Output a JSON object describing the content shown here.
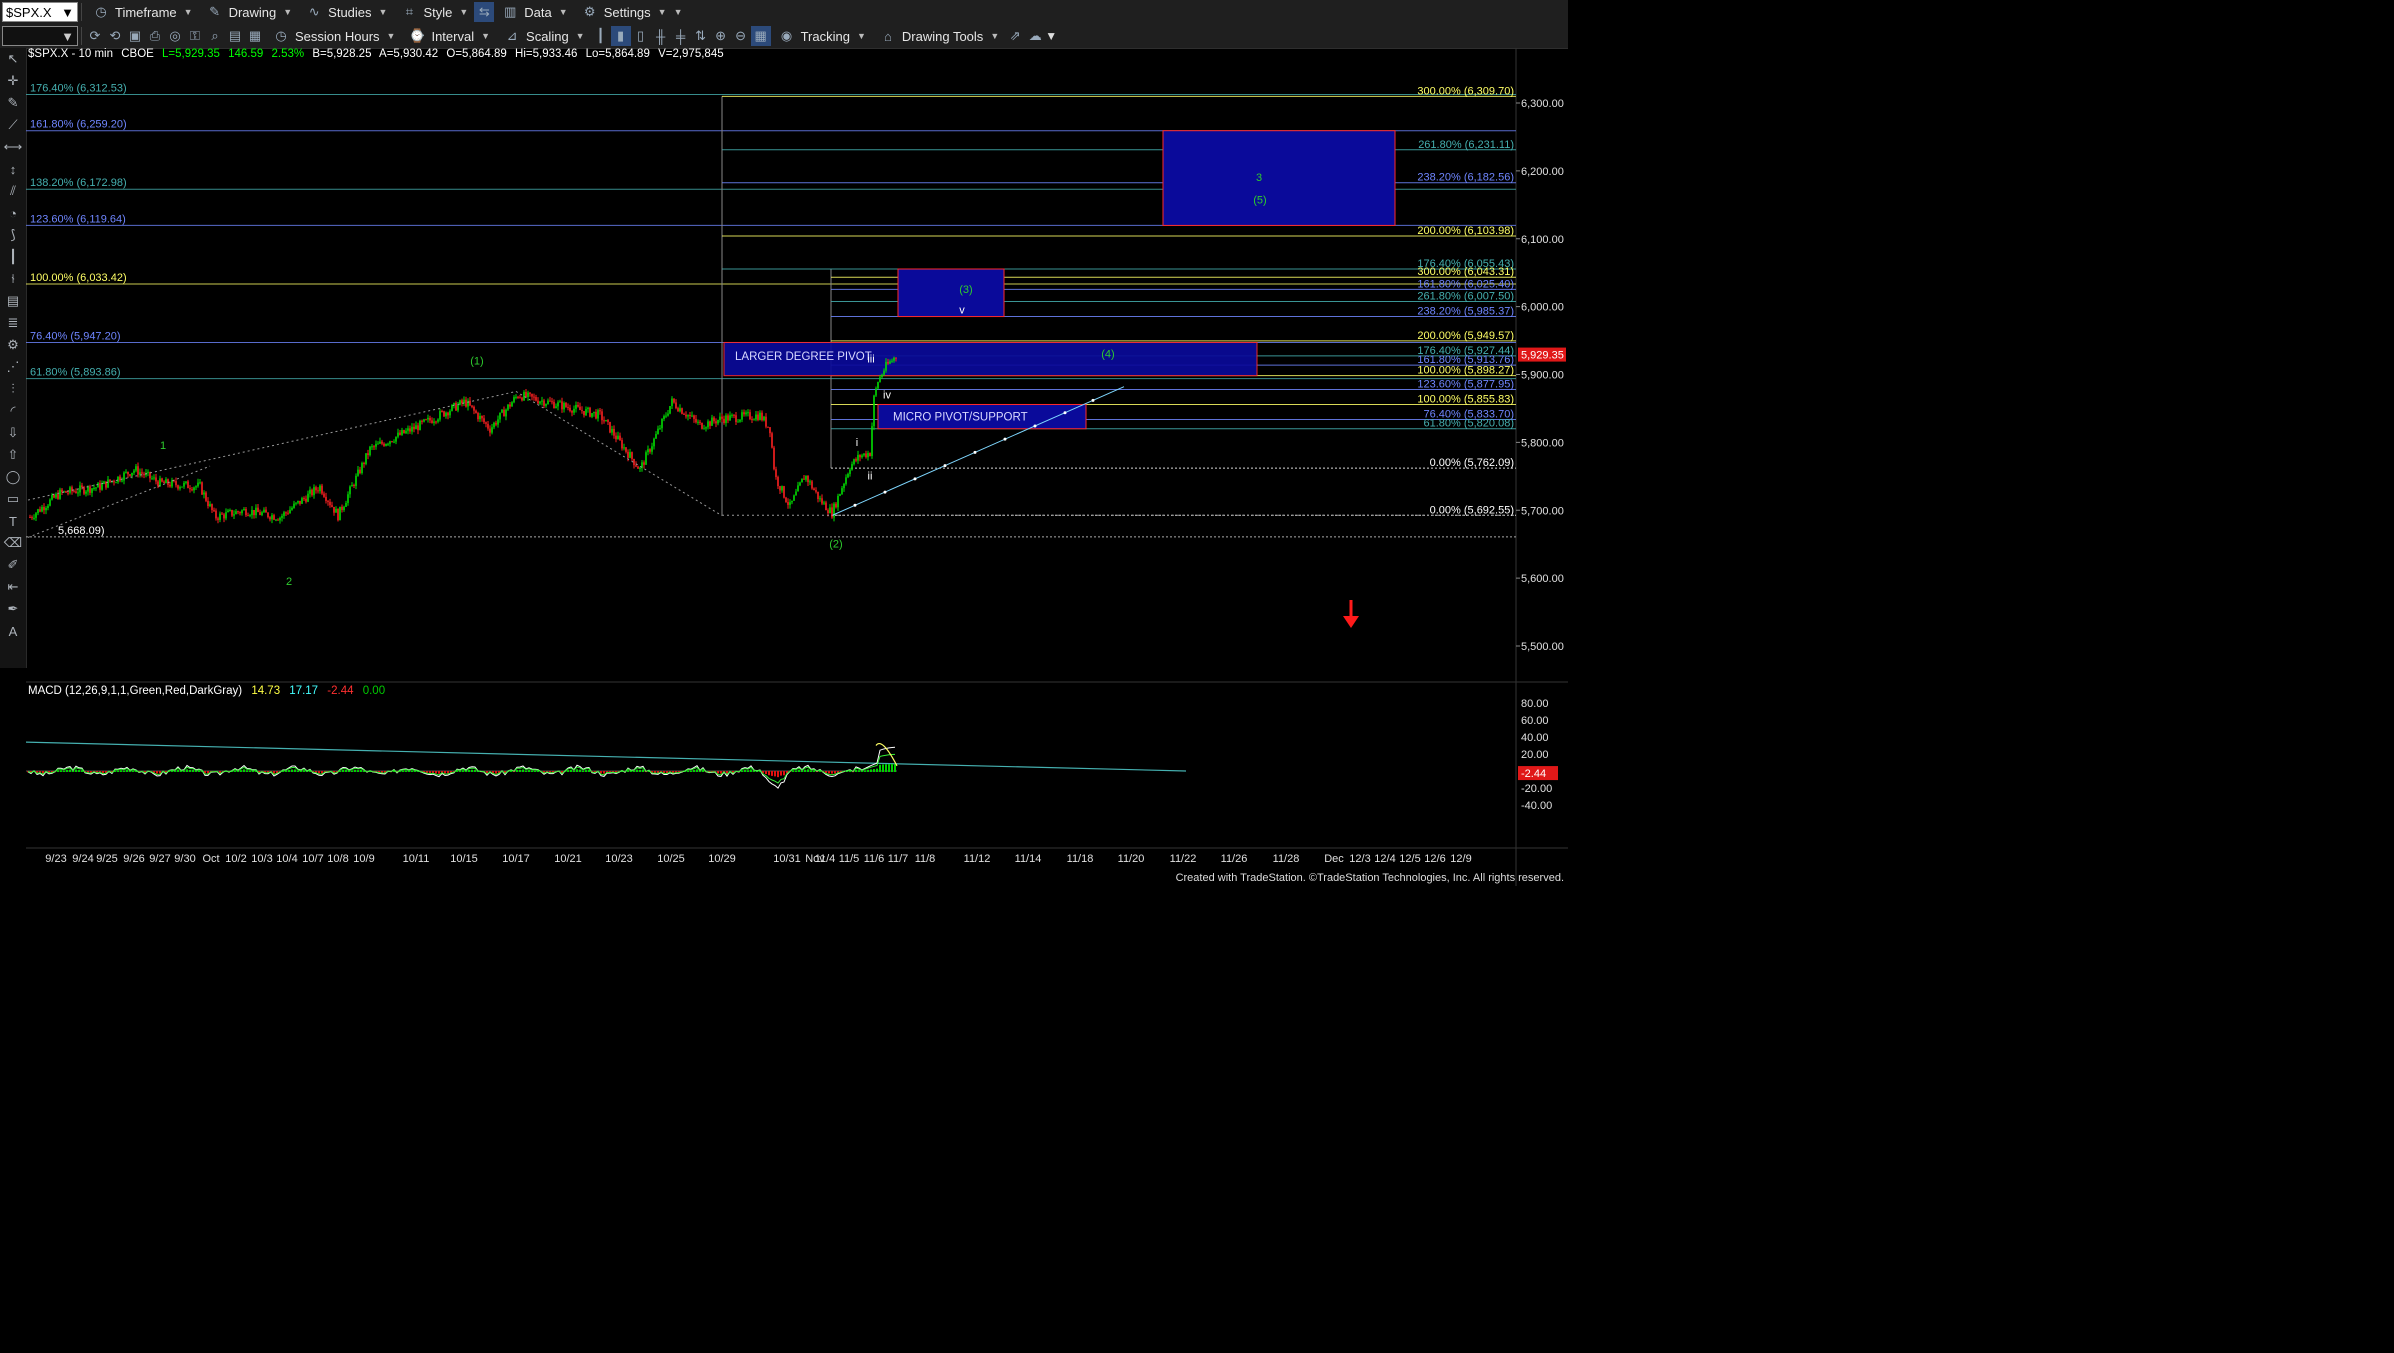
{
  "toolbar1": {
    "symbol": "$SPX.X",
    "items": [
      {
        "label": "Timeframe",
        "icon": "clock-icon"
      },
      {
        "label": "Drawing",
        "icon": "pencil-icon"
      },
      {
        "label": "Studies",
        "icon": "studies-icon"
      },
      {
        "label": "Style",
        "icon": "style-icon"
      },
      {
        "label": "Data",
        "icon": "data-icon"
      },
      {
        "label": "Settings",
        "icon": "gear-icon"
      }
    ]
  },
  "toolbar2": {
    "session_hours": "Session Hours",
    "interval": "Interval",
    "scaling": "Scaling",
    "tracking": "Tracking",
    "drawing_tools": "Drawing Tools"
  },
  "header": {
    "symbol": "$SPX.X - 10 min",
    "exchange": "CBOE",
    "last": "L=5,929.35",
    "change": "146.59",
    "pct": "2.53%",
    "bid": "B=5,928.25",
    "ask": "A=5,930.42",
    "open": "O=5,864.89",
    "high": "Hi=5,933.46",
    "low": "Lo=5,864.89",
    "volume": "V=2,975,845"
  },
  "macd": {
    "label": "MACD (12,26,9,1,1,Green,Red,DarkGray)",
    "v1": "14.73",
    "v2": "17.17",
    "v3": "-2.44",
    "v4": "0.00",
    "current_tag": "-2.44"
  },
  "colors": {
    "up": "#00e000",
    "down": "#ff2020",
    "fib_yellow": "#ffff66",
    "fib_blue": "#6f86ff",
    "fib_teal": "#45b0b0",
    "zone_fill": "#0a0a9a",
    "zone_border": "#ff2a2a",
    "wave_green": "#2ecc2e"
  },
  "price_axis": {
    "ticks": [
      "6,300.00",
      "6,200.00",
      "6,100.00",
      "6,000.00",
      "5,900.00",
      "5,800.00",
      "5,700.00",
      "5,600.00",
      "5,500.00"
    ],
    "ticks_values": [
      6300,
      6200,
      6100,
      6000,
      5900,
      5800,
      5700,
      5600,
      5500
    ],
    "last_price": "5,929.35"
  },
  "macd_axis": {
    "ticks": [
      "80.00",
      "60.00",
      "40.00",
      "20.00",
      "-20.00",
      "-40.00"
    ],
    "ticks_values": [
      80,
      60,
      40,
      20,
      -20,
      -40
    ]
  },
  "time_axis": [
    "9/23",
    "9/24",
    "9/25",
    "9/26",
    "9/27",
    "9/30",
    "Oct",
    "10/2",
    "10/3",
    "10/4",
    "10/7",
    "10/8",
    "10/9",
    "10/11",
    "10/15",
    "10/17",
    "10/21",
    "10/23",
    "10/25",
    "10/29",
    "10/31",
    "Nov",
    "11/4",
    "11/5",
    "11/6",
    "11/7",
    "11/8",
    "11/12",
    "11/14",
    "11/18",
    "11/20",
    "11/22",
    "11/26",
    "11/28",
    "Dec",
    "12/3",
    "12/4",
    "12/5",
    "12/6",
    "12/9"
  ],
  "left_fibs": [
    {
      "label": "176.40% (6,312.53)",
      "price": 6312.53,
      "color": "teal"
    },
    {
      "label": "161.80% (6,259.20)",
      "price": 6259.2,
      "color": "blue"
    },
    {
      "label": "138.20% (6,172.98)",
      "price": 6172.98,
      "color": "teal"
    },
    {
      "label": "123.60% (6,119.64)",
      "price": 6119.64,
      "color": "blue"
    },
    {
      "label": "100.00% (6,033.42)",
      "price": 6033.42,
      "color": "yellow"
    },
    {
      "label": "76.40% (5,947.20)",
      "price": 5947.2,
      "color": "blue"
    },
    {
      "label": "61.80% (5,893.86)",
      "price": 5893.86,
      "color": "teal"
    },
    {
      "label": "5,668.09)",
      "price": 5668.09,
      "color": "white"
    }
  ],
  "right_fibs": [
    {
      "label": "300.00% (6,309.70)",
      "price": 6309.7,
      "color": "yellow"
    },
    {
      "label": "261.80% (6,231.11)",
      "price": 6231.11,
      "color": "teal"
    },
    {
      "label": "238.20% (6,182.56)",
      "price": 6182.56,
      "color": "blue"
    },
    {
      "label": "200.00% (6,103.98)",
      "price": 6103.98,
      "color": "yellow"
    },
    {
      "label": "176.40% (6,055.43)",
      "price": 6055.43,
      "color": "teal"
    },
    {
      "label": "300.00% (6,043.31)",
      "price": 6043.31,
      "color": "yellow"
    },
    {
      "label": "161.80% (6,025.40)",
      "price": 6025.4,
      "color": "blue"
    },
    {
      "label": "261.80% (6,007.50)",
      "price": 6007.5,
      "color": "teal"
    },
    {
      "label": "238.20% (5,985.37)",
      "price": 5985.37,
      "color": "blue"
    },
    {
      "label": "200.00% (5,949.57)",
      "price": 5949.57,
      "color": "yellow"
    },
    {
      "label": "176.40% (5,927.44)",
      "price": 5927.44,
      "color": "teal"
    },
    {
      "label": "161.80% (5,913.76)",
      "price": 5913.76,
      "color": "blue"
    },
    {
      "label": "100.00% (5,898.27)",
      "price": 5898.27,
      "color": "yellow"
    },
    {
      "label": "123.60% (5,877.95)",
      "price": 5877.95,
      "color": "blue"
    },
    {
      "label": "100.00% (5,855.83)",
      "price": 5855.83,
      "color": "yellow"
    },
    {
      "label": "76.40% (5,833.70)",
      "price": 5833.7,
      "color": "blue"
    },
    {
      "label": "61.80% (5,820.08)",
      "price": 5820.08,
      "color": "teal"
    },
    {
      "label": "0.00% (5,762.09)",
      "price": 5762.09,
      "color": "white"
    },
    {
      "label": "0.00% (5,692.55)",
      "price": 5692.55,
      "color": "white"
    }
  ],
  "zones": {
    "larger_degree_pivot": "LARGER DEGREE PIVOT",
    "micro_pivot": "MICRO PIVOT/SUPPORT"
  },
  "waves": {
    "w1": "1",
    "w2": "2",
    "w3": "3",
    "w_p1": "(1)",
    "w_p2": "(2)",
    "w_p3": "(3)",
    "w_p4": "(4)",
    "w_p5": "(5)",
    "wi": "i",
    "wii": "ii",
    "wiii": "iii",
    "wiv": "iv",
    "wv": "v"
  },
  "footer": "Created with TradeStation. ©TradeStation Technologies, Inc. All rights reserved."
}
